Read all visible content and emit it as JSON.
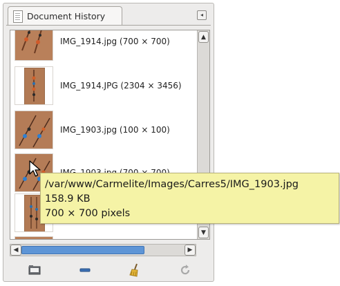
{
  "dock": {
    "tab_label": "Document History",
    "tab_icon": "document-icon",
    "menu_icon": "tab-menu-icon"
  },
  "history": {
    "items": [
      {
        "label": "IMG_1914.jpg (700 × 700)",
        "thumb": "square"
      },
      {
        "label": "IMG_1914.JPG (2304 × 3456)",
        "thumb": "portrait"
      },
      {
        "label": "IMG_1903.jpg (100 × 100)",
        "thumb": "square"
      },
      {
        "label": "IMG_1903.jpg (700 × 700)",
        "thumb": "square"
      },
      {
        "label": "",
        "thumb": "portrait"
      },
      {
        "label": "",
        "thumb": "square"
      }
    ]
  },
  "tooltip": {
    "path": "/var/www/Carmelite/Images/Carres5/IMG_1903.jpg",
    "size": "158.9 KB",
    "dimensions": "700 × 700 pixels"
  },
  "buttons": [
    {
      "name": "open-image-button",
      "icon": "open-folder-icon"
    },
    {
      "name": "remove-entry-button",
      "icon": "minus-icon"
    },
    {
      "name": "clear-history-button",
      "icon": "broom-icon"
    },
    {
      "name": "recreate-preview-button",
      "icon": "reload-icon"
    }
  ],
  "colors": {
    "accent": "#5e95d6",
    "tooltip_bg": "#f5f3a6",
    "panel_bg": "#edeceb"
  }
}
